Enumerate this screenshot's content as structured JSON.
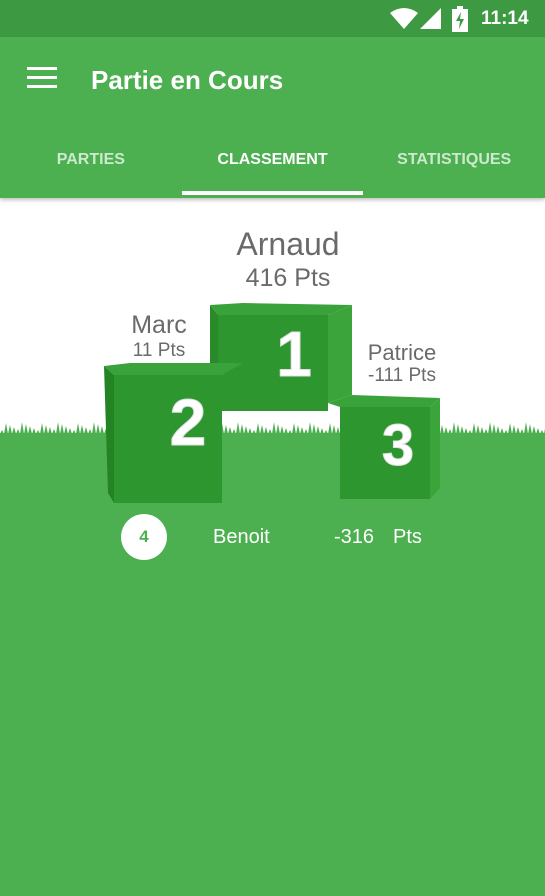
{
  "status_bar": {
    "time": "11:14",
    "icons": [
      "wifi-icon",
      "signal-icon",
      "battery-icon"
    ]
  },
  "app_bar": {
    "title": "Partie en Cours",
    "menu_icon": "menu-icon"
  },
  "tabs": [
    {
      "label": "PARTIES",
      "active": false
    },
    {
      "label": "CLASSEMENT",
      "active": true
    },
    {
      "label": "STATISTIQUES",
      "active": false
    }
  ],
  "podium": {
    "first": {
      "name": "Arnaud",
      "score": "416 Pts",
      "rank": "1"
    },
    "second": {
      "name": "Marc",
      "score": "11 Pts",
      "rank": "2"
    },
    "third": {
      "name": "Patrice",
      "score": "-111 Pts",
      "rank": "3"
    }
  },
  "others": [
    {
      "rank": "4",
      "name": "Benoit",
      "score": "-316",
      "unit": "Pts"
    }
  ],
  "colors": {
    "primary": "#4caf50",
    "status_bar": "#3e9a42",
    "text_gray": "#6a6a6a"
  }
}
